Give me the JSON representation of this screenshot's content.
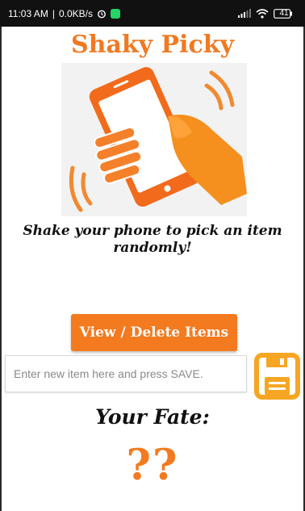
{
  "status_bar": {
    "time": "11:03 AM",
    "network_speed": "0.0KB/s",
    "battery": "41",
    "icons": [
      "alarm-icon",
      "whatsapp-icon",
      "signal-icon",
      "wifi-icon",
      "battery-icon"
    ]
  },
  "app": {
    "title": "Shaky Picky",
    "tagline": "Shake your phone to pick an item randomly!",
    "accent_color": "#f47a1f"
  },
  "actions": {
    "view_delete_label": "View / Delete Items",
    "save_icon": "floppy-disk-icon"
  },
  "input": {
    "placeholder": "Enter new item here and press SAVE.",
    "value": ""
  },
  "fate": {
    "label": "Your Fate:",
    "value": "??"
  }
}
